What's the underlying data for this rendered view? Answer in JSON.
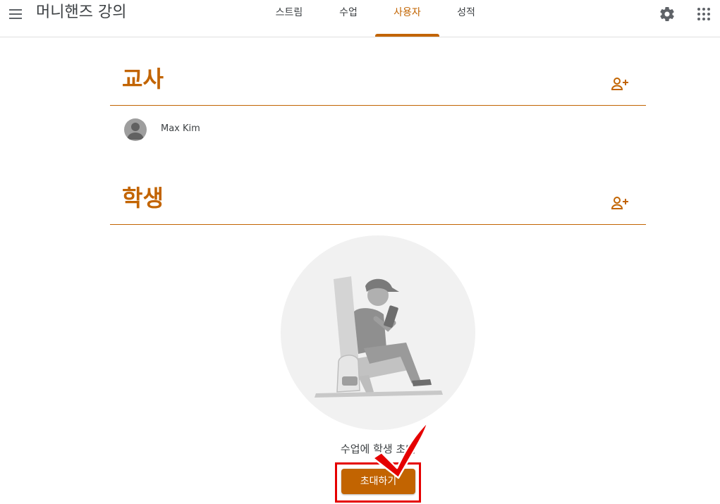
{
  "header": {
    "class_title": "머니핸즈 강의",
    "tabs": [
      {
        "label": "스트림",
        "active": false
      },
      {
        "label": "수업",
        "active": false
      },
      {
        "label": "사용자",
        "active": true
      },
      {
        "label": "성적",
        "active": false
      }
    ],
    "icons": [
      "menu-icon",
      "gear-icon",
      "apps-icon"
    ]
  },
  "teachers": {
    "title": "교사",
    "add_icon": "add-person-icon",
    "members": [
      {
        "name": "Max Kim",
        "avatar": "avatar-icon"
      }
    ]
  },
  "students": {
    "title": "학생",
    "add_icon": "add-person-icon",
    "empty_message": "수업에 학생 초대",
    "invite_button": "초대하기"
  },
  "colors": {
    "accent": "#c26401",
    "highlight": "#e50000",
    "divider": "#e0e0e0"
  }
}
